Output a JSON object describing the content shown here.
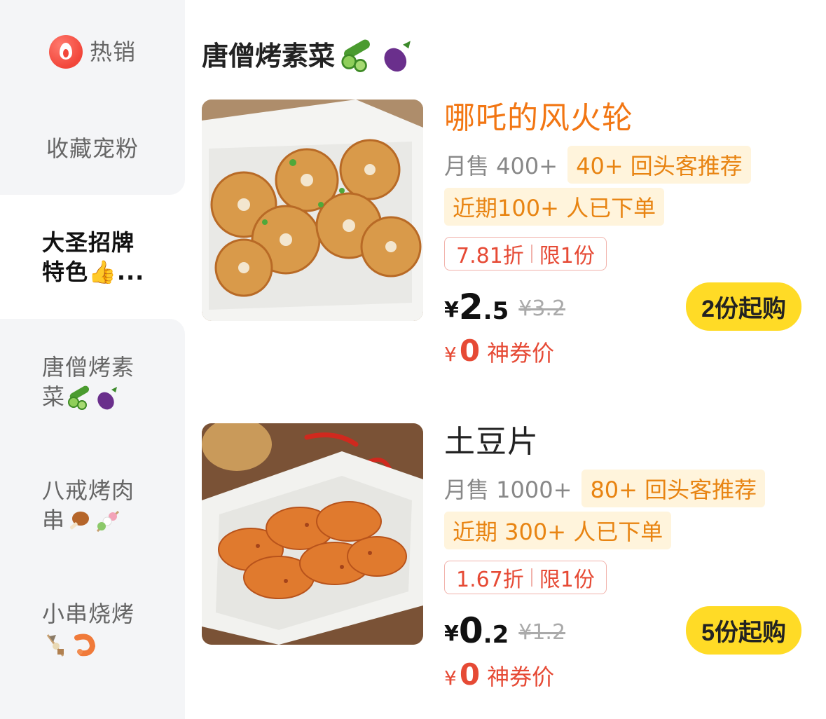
{
  "sidebar": {
    "items": [
      {
        "label": "热销"
      },
      {
        "label": "收藏宠粉"
      },
      {
        "label": "大圣招牌特色👍..."
      },
      {
        "label": "唐僧烤素菜"
      },
      {
        "label": "八戒烤肉串"
      },
      {
        "label": "小串烧烤"
      }
    ]
  },
  "section": {
    "title": "唐僧烤素菜"
  },
  "products": [
    {
      "name": "哪吒的风火轮",
      "sales": "月售 400+",
      "repeat_tag": "40+ 回头客推荐",
      "recent_tag": "近期100+ 人已下单",
      "discount": "7.81折",
      "limit": "限1份",
      "yen": "¥",
      "price_int": "2",
      "price_dec": ".5",
      "old_price": "¥3.2",
      "buy_label": "2份起购",
      "coupon_yen": "¥",
      "coupon_value": "0",
      "coupon_label": "神券价"
    },
    {
      "name": "土豆片",
      "sales": "月售 1000+",
      "repeat_tag": "80+ 回头客推荐",
      "recent_tag": "近期 300+ 人已下单",
      "discount": "1.67折",
      "limit": "限1份",
      "yen": "¥",
      "price_int": "0",
      "price_dec": ".2",
      "old_price": "¥1.2",
      "buy_label": "5份起购",
      "coupon_yen": "¥",
      "coupon_value": "0",
      "coupon_label": "神券价"
    }
  ],
  "icons": {
    "hot": "flame-icon",
    "cucumber": "cucumber-icon",
    "eggplant": "eggplant-icon",
    "drumstick": "drumstick-icon",
    "dango": "dango-icon",
    "oden": "oden-icon",
    "shrimp": "shrimp-icon"
  },
  "colors": {
    "accent_orange": "#f27613",
    "price_red": "#e64a35",
    "button_yellow": "#ffdb26",
    "tag_bg": "#fff4dc",
    "sidebar_bg": "#f4f5f7"
  }
}
